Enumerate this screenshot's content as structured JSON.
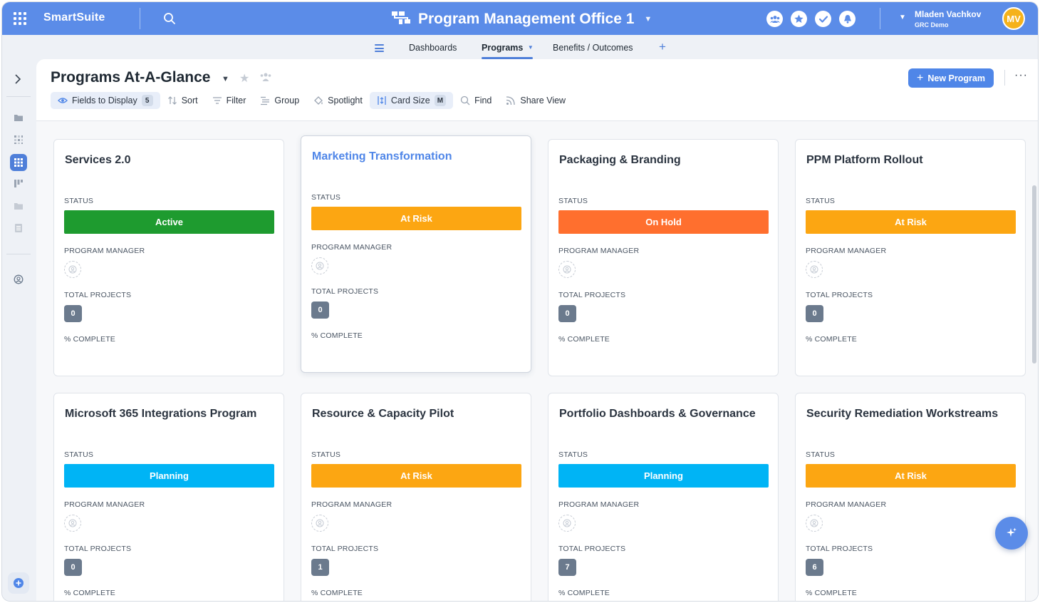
{
  "topbar": {
    "brand": "SmartSuite",
    "workspace_title": "Program Management Office 1",
    "user_name": "Mladen Vachkov",
    "user_org": "GRC Demo",
    "user_initials": "MV",
    "icons": [
      "apps-grid-icon",
      "search-icon",
      "hierarchy-icon",
      "team-icon",
      "star-icon",
      "check-icon",
      "bell-icon"
    ]
  },
  "nav": {
    "items": [
      {
        "label": "Dashboards"
      },
      {
        "label": "Programs"
      },
      {
        "label": "Benefits / Outcomes"
      }
    ],
    "active": "Programs",
    "add_label": "+"
  },
  "view": {
    "title": "Programs At-A-Glance",
    "new_button_label": "New Program",
    "toolbar": {
      "fields_label": "Fields to Display",
      "fields_count": "5",
      "sort_label": "Sort",
      "filter_label": "Filter",
      "group_label": "Group",
      "spotlight_label": "Spotlight",
      "card_size_label": "Card Size",
      "card_size_value": "M",
      "find_label": "Find",
      "share_label": "Share View"
    }
  },
  "field_labels": {
    "status": "STATUS",
    "manager": "PROGRAM MANAGER",
    "projects": "TOTAL PROJECTS",
    "complete": "% COMPLETE"
  },
  "status_colors": {
    "Active": "#1e9b2f",
    "At Risk": "#fca612",
    "On Hold": "#ff6f2e",
    "Planning": "#00b4f5"
  },
  "cards": [
    {
      "title": "Services 2.0",
      "status": "Active",
      "projects": "0"
    },
    {
      "title": "Marketing Transformation",
      "status": "At Risk",
      "projects": "0"
    },
    {
      "title": "Packaging & Branding",
      "status": "On Hold",
      "projects": "0"
    },
    {
      "title": "PPM Platform Rollout",
      "status": "At Risk",
      "projects": "0"
    },
    {
      "title": "Microsoft 365 Integrations Program",
      "status": "Planning",
      "projects": "0"
    },
    {
      "title": "Resource & Capacity Pilot",
      "status": "At Risk",
      "projects": "1"
    },
    {
      "title": "Portfolio Dashboards & Governance",
      "status": "Planning",
      "projects": "7"
    },
    {
      "title": "Security Remediation Workstreams",
      "status": "At Risk",
      "projects": "6"
    }
  ]
}
